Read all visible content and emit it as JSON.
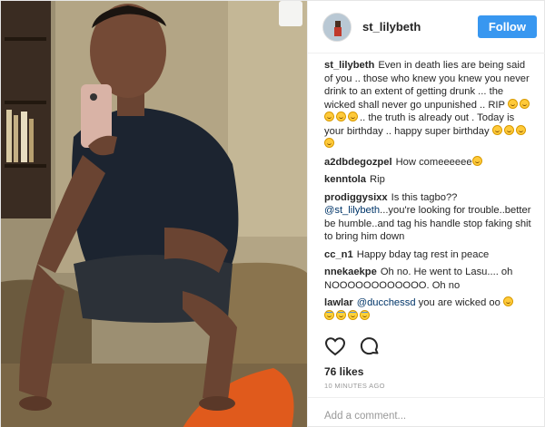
{
  "post": {
    "username": "st_lilybeth",
    "follow_label": "Follow",
    "likes": "76 likes",
    "timestamp": "10 MINUTES AGO",
    "add_comment_placeholder": "Add a comment..."
  },
  "comments": [
    {
      "user": "st_lilybeth",
      "text_a": "Even in death lies are being said of you .. those who knew you knew you never drink to an extent of getting drunk ... the wicked shall never go unpunished .. RIP ",
      "text_b": ".. the truth is already out . Today is your birthday .. happy super birthday ",
      "emoji_a": [
        "sad-face-emoji",
        "sad-face-emoji",
        "sad-face-emoji",
        "sad-face-emoji",
        "sad-face-emoji"
      ],
      "emoji_b": [
        "sad-face-emoji",
        "sad-face-emoji",
        "sad-face-emoji",
        "sad-face-emoji"
      ]
    },
    {
      "user": "a2dbdegozpel",
      "text": "How comeeeeee",
      "emoji": "flushed-face-emoji"
    },
    {
      "user": "kenntola",
      "text": "Rip"
    },
    {
      "user": "prodiggysixx",
      "text_a": "Is this tagbo?? ",
      "mention": "@st_lilybeth",
      "text_b": "...you're looking for trouble..better be humble..and tag his handle stop faking shit to bring him down"
    },
    {
      "user": "cc_n1",
      "text": "Happy bday tag rest in peace"
    },
    {
      "user": "nnekaekpe",
      "text": "Oh no. He went to Lasu.... oh NOOOOOOOOOOOO. Oh no"
    },
    {
      "user": "lawlar",
      "mention": "@ducchessd",
      "text": " you are wicked oo ",
      "emoji": [
        "flushed-face-emoji",
        "laughing-crying-emoji",
        "laughing-crying-emoji",
        "laughing-crying-emoji",
        "laughing-crying-emoji"
      ]
    }
  ],
  "icons": {
    "like": "heart-icon",
    "comment": "comment-icon"
  },
  "colors": {
    "follow_button": "#3897f0",
    "mention": "#003569",
    "meta_text": "#999999"
  }
}
